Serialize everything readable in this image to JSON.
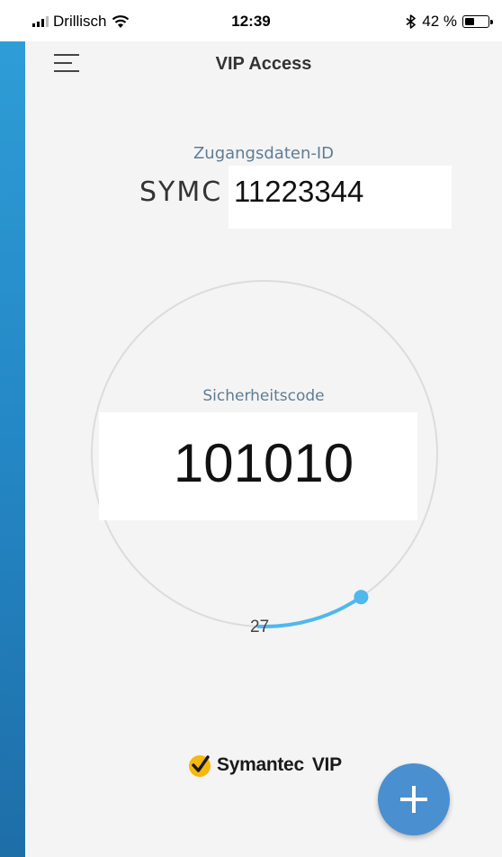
{
  "status_bar": {
    "carrier": "Drillisch",
    "time": "12:39",
    "battery": "42 %",
    "battery_level": 0.42,
    "icons": [
      "signal-bars-icon",
      "wifi-icon",
      "bluetooth-icon",
      "battery-icon"
    ]
  },
  "nav": {
    "title": "VIP Access",
    "menu_icon": "hamburger-menu-icon"
  },
  "credential": {
    "label": "Zugangsdaten-ID",
    "prefix": "SYMC",
    "value": "11223344"
  },
  "security_code": {
    "label": "Sicherheitscode",
    "value": "101010",
    "seconds_remaining": "27",
    "timer_total_seconds": 30
  },
  "brand": {
    "name": "Symantec",
    "suffix": "VIP",
    "logo_icon": "symantec-checkmark-logo-icon"
  },
  "fab": {
    "icon": "plus-icon"
  },
  "colors": {
    "accent": "#4fb8ec",
    "fab": "#4a8fd0",
    "label": "#5f7c93",
    "ring": "#dcdcdc",
    "logo_yellow": "#f5b80c"
  }
}
